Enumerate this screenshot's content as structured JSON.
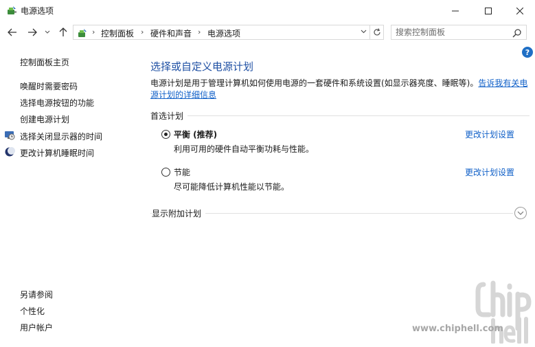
{
  "window": {
    "title": "电源选项"
  },
  "address": {
    "crumbs": [
      "控制面板",
      "硬件和声音",
      "电源选项"
    ]
  },
  "search": {
    "placeholder": "搜索控制面板"
  },
  "help": {
    "glyph": "?"
  },
  "sidebar": {
    "home": "控制面板主页",
    "items": [
      {
        "label": "唤醒时需要密码"
      },
      {
        "label": "选择电源按钮的功能"
      },
      {
        "label": "创建电源计划"
      },
      {
        "label": "选择关闭显示器的时间",
        "icon": "monitor-clock-icon"
      },
      {
        "label": "更改计算机睡眠时间",
        "icon": "moon-icon"
      }
    ],
    "see_also": {
      "heading": "另请参阅",
      "items": [
        {
          "label": "个性化"
        },
        {
          "label": "用户帐户"
        }
      ]
    }
  },
  "main": {
    "title": "选择或自定义电源计划",
    "description": "电源计划是用于管理计算机如何使用电源的一套硬件和系统设置(如显示器亮度、睡眠等)。",
    "description_link": "告诉我有关电源计划的详细信息",
    "preferred_heading": "首选计划",
    "plans": [
      {
        "name": "平衡 (推荐)",
        "description": "利用可用的硬件自动平衡功耗与性能。",
        "link": "更改计划设置",
        "selected": true
      },
      {
        "name": "节能",
        "description": "尽可能降低计算机性能以节能。",
        "link": "更改计划设置",
        "selected": false
      }
    ],
    "additional_heading": "显示附加计划"
  },
  "watermark": {
    "site": "www.chiphell.com",
    "logo": "chiphell"
  },
  "colors": {
    "link": "#1060c8",
    "title": "#1e4fa3",
    "help": "#1f6fc5"
  }
}
